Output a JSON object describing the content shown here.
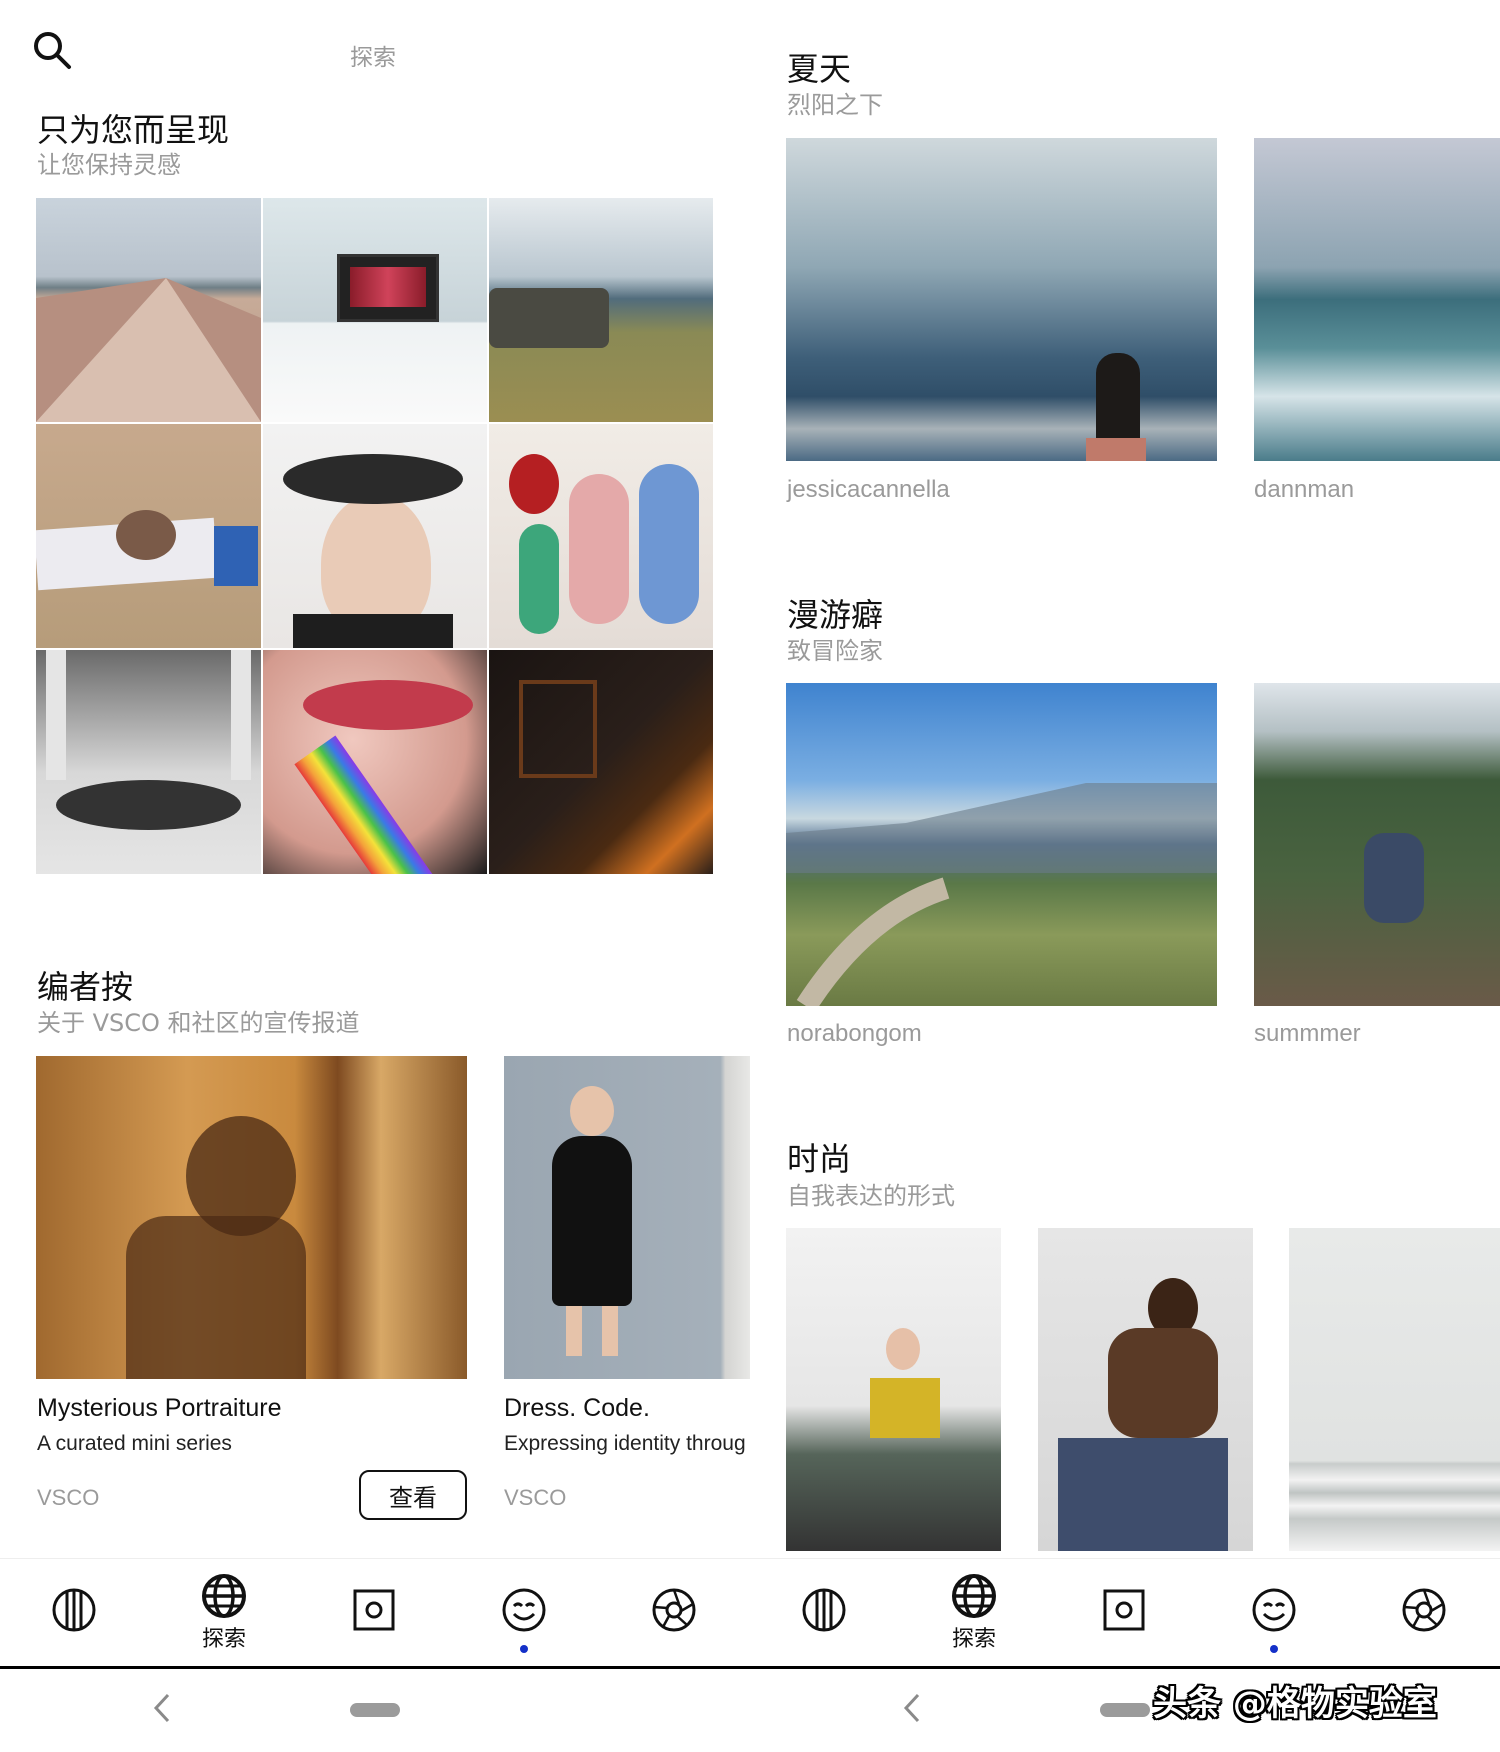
{
  "left_screen": {
    "search_title": "探索",
    "for_you": {
      "title": "只为您而呈现",
      "subtitle": "让您保持灵感"
    },
    "editors": {
      "title": "编者按",
      "subtitle": "关于 VSCO 和社区的宣传报道",
      "cards": [
        {
          "title": "Mysterious Portraiture",
          "subtitle": "A curated mini series",
          "source": "VSCO",
          "button": "查看"
        },
        {
          "title": "Dress. Code.",
          "subtitle": "Expressing identity throug",
          "source": "VSCO"
        }
      ]
    }
  },
  "right_screen": {
    "summer": {
      "title": "夏天",
      "subtitle": "烈阳之下",
      "credits": [
        "jessicacannella",
        "dannman"
      ]
    },
    "wanderlust": {
      "title": "漫游癖",
      "subtitle": "致冒险家",
      "credits": [
        "norabongom",
        "summmer"
      ]
    },
    "fashion": {
      "title": "时尚",
      "subtitle": "自我表达的形式"
    }
  },
  "tabbar": {
    "explore_label": "探索"
  },
  "watermark": "头条 @格物实验室",
  "colors": {
    "accent_dot": "#1430c8",
    "subtitle_gray": "#9a9a9a"
  }
}
